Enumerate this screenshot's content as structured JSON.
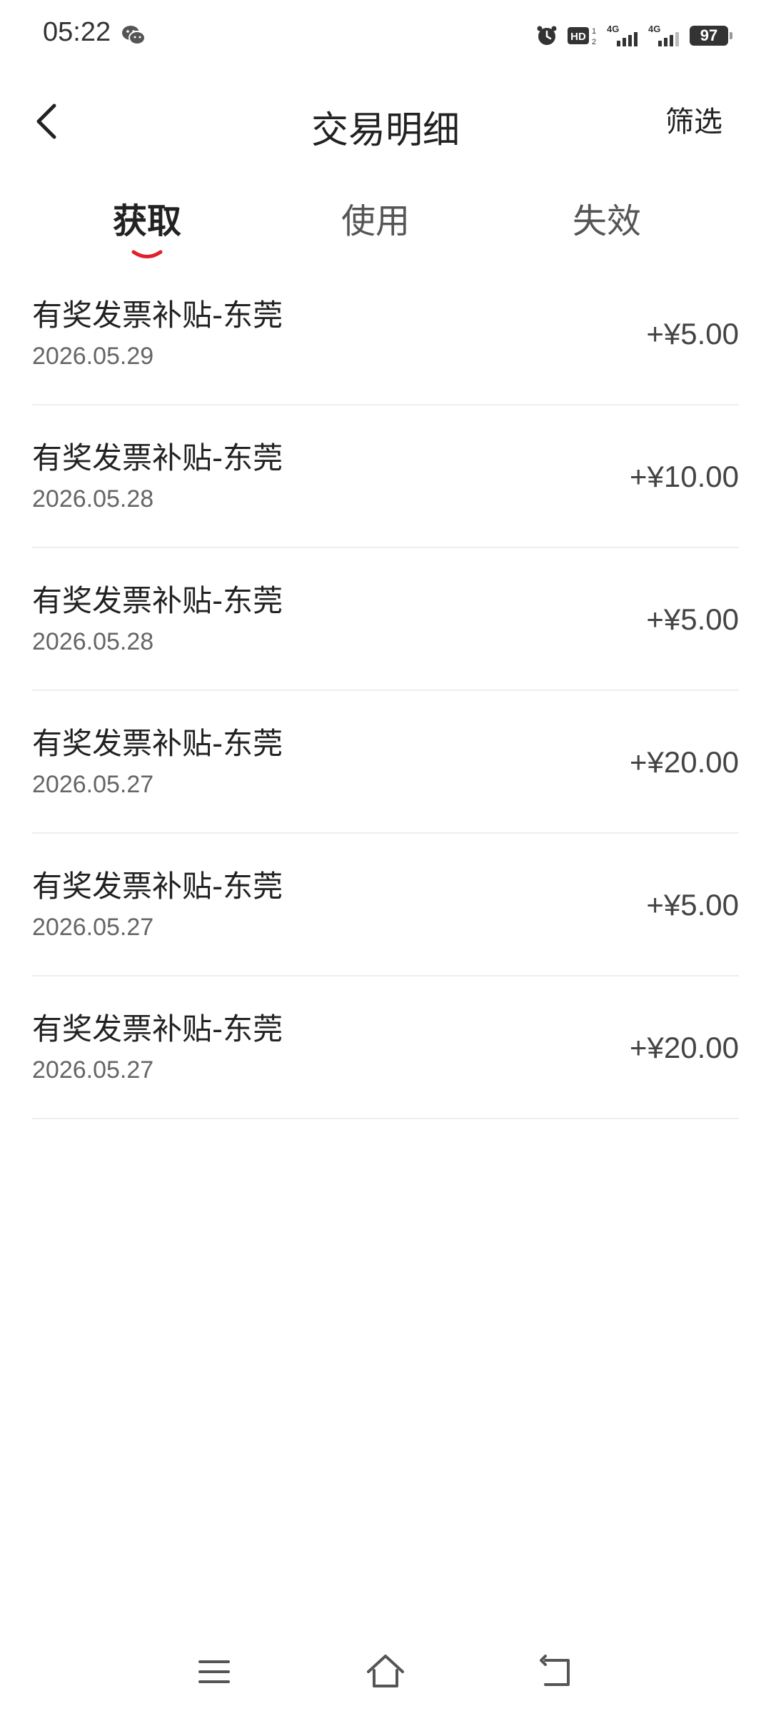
{
  "status_bar": {
    "time": "05:22",
    "battery": "97",
    "icons": [
      "wechat-icon",
      "alarm-icon",
      "hd-icon",
      "signal-4g-icon",
      "signal-4g-icon",
      "battery-icon"
    ]
  },
  "header": {
    "title": "交易明细",
    "filter_label": "筛选"
  },
  "tabs": [
    {
      "label": "获取",
      "active": true
    },
    {
      "label": "使用",
      "active": false
    },
    {
      "label": "失效",
      "active": false
    }
  ],
  "transactions": [
    {
      "title": "有奖发票补贴-东莞",
      "date": "2026.05.29",
      "amount": "+¥5.00"
    },
    {
      "title": "有奖发票补贴-东莞",
      "date": "2026.05.28",
      "amount": "+¥10.00"
    },
    {
      "title": "有奖发票补贴-东莞",
      "date": "2026.05.28",
      "amount": "+¥5.00"
    },
    {
      "title": "有奖发票补贴-东莞",
      "date": "2026.05.27",
      "amount": "+¥20.00"
    },
    {
      "title": "有奖发票补贴-东莞",
      "date": "2026.05.27",
      "amount": "+¥5.00"
    },
    {
      "title": "有奖发票补贴-东莞",
      "date": "2026.05.27",
      "amount": "+¥20.00"
    }
  ],
  "colors": {
    "accent": "#e0202a",
    "text": "#222222",
    "secondary_text": "#666666",
    "divider": "#eeeeee"
  },
  "nav": {
    "icons": [
      "menu-icon",
      "home-icon",
      "back-icon"
    ]
  }
}
